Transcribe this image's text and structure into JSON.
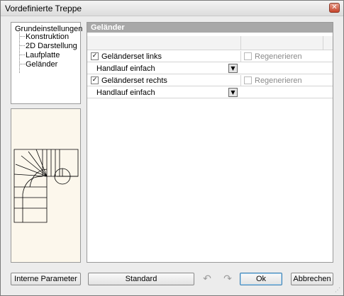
{
  "window": {
    "title": "Vordefinierte Treppe",
    "close_glyph": "✕"
  },
  "tree": {
    "root": "Grundeinstellungen",
    "items": [
      "Konstruktion",
      "2D Darstellung",
      "Laufplatte",
      "Geländer"
    ]
  },
  "panel": {
    "header": "Geländer",
    "rows": [
      {
        "type": "check",
        "label": "Geländerset links",
        "checked": true,
        "glyph": "✓",
        "regen_label": "Regenerieren"
      },
      {
        "type": "select",
        "value": "Handlauf einfach"
      },
      {
        "type": "check",
        "label": "Geländerset rechts",
        "checked": true,
        "glyph": "✓",
        "regen_label": "Regenerieren"
      },
      {
        "type": "select",
        "value": "Handlauf einfach"
      }
    ]
  },
  "buttons": {
    "internal_params": "Interne Parameter",
    "standard": "Standard",
    "ok": "Ok",
    "cancel": "Abbrechen"
  },
  "icons": {
    "undo": "undo-icon",
    "redo": "redo-icon",
    "dropdown": "▼",
    "undo_glyph": "↶",
    "redo_glyph": "↷"
  }
}
